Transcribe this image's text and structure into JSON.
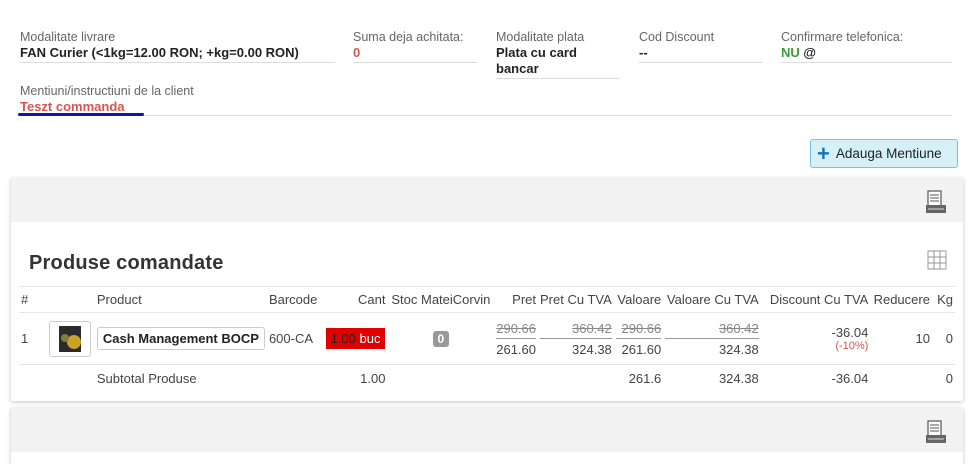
{
  "delivery": {
    "label": "Modalitate livrare",
    "value": "FAN Curier (<1kg=12.00 RON; +kg=0.00 RON)"
  },
  "paid": {
    "label": "Suma deja achitata:",
    "value": "0"
  },
  "payment": {
    "label": "Modalitate plata",
    "value": "Plata cu card bancar"
  },
  "discount_code": {
    "label": "Cod Discount",
    "value": "--"
  },
  "phone_confirm": {
    "label": "Confirmare telefonica:",
    "value": "NU",
    "suffix": "@"
  },
  "client_notes": {
    "label": "Mentiuni/instructiuni de la client",
    "value": "Teszt commanda"
  },
  "add_mention_button": "Adauga Mentiune",
  "products_title": "Produse comandate",
  "columns": [
    "#",
    "Product",
    "Barcode",
    "Cant",
    "Stoc MateiCorvin",
    "Pret",
    "Pret Cu TVA",
    "Valoare",
    "Valoare Cu TVA",
    "Discount Cu TVA",
    "Reducere",
    "Kg"
  ],
  "products": [
    {
      "index": "1",
      "name": "Cash Management BOCP",
      "barcode": "600-CA",
      "qty": "1.00",
      "unit": "buc",
      "stock": "0",
      "price_old": "290.66",
      "price": "261.60",
      "price_vat_old": "360.42",
      "price_vat": "324.38",
      "value_old": "290.66",
      "value": "261.60",
      "value_vat_old": "360.42",
      "value_vat": "324.38",
      "discount_vat": "-36.04",
      "discount_pct": "(-10%)",
      "reduction": "10",
      "kg": "0"
    }
  ],
  "subtotal": {
    "label": "Subtotal Produse",
    "qty": "1.00",
    "value": "261.6",
    "value_vat": "324.38",
    "discount_vat": "-36.04",
    "kg": "0"
  },
  "colors": {
    "accent_red": "#d9534f",
    "accent_green": "#3c9b3c",
    "qty_red": "#e00000",
    "button_bg": "#d6f0f7"
  }
}
